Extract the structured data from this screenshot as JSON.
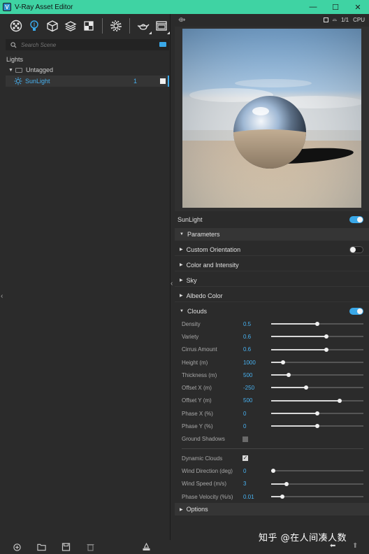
{
  "window": {
    "title": "V-Ray Asset Editor",
    "minimize": "—",
    "maximize": "☐",
    "close": "✕"
  },
  "toolbar": {
    "icons": [
      "materials-icon",
      "lights-icon",
      "geometry-icon",
      "render-elements-icon",
      "textures-icon",
      "settings-icon",
      "teapot-icon",
      "render-window-icon"
    ]
  },
  "search": {
    "placeholder": "Search Scene"
  },
  "tree": {
    "title": "Lights",
    "group": "Untagged",
    "item": {
      "name": "SunLight",
      "count": "1"
    }
  },
  "render_bar": {
    "mode": "CPU",
    "ratio": "1/1"
  },
  "props": {
    "object_name": "SunLight",
    "object_enabled": true,
    "section_parameters": "Parameters",
    "subsections": [
      {
        "label": "Custom Orientation",
        "toggle": "off"
      },
      {
        "label": "Color and Intensity"
      },
      {
        "label": "Sky"
      },
      {
        "label": "Albedo Color"
      }
    ],
    "clouds": {
      "label": "Clouds",
      "enabled": true,
      "params": [
        {
          "label": "Density",
          "value": "0.5",
          "pos": 0.5
        },
        {
          "label": "Variety",
          "value": "0.6",
          "pos": 0.6
        },
        {
          "label": "Cirrus Amount",
          "value": "0.6",
          "pos": 0.6
        },
        {
          "label": "Height (m)",
          "value": "1000",
          "pos": 0.13
        },
        {
          "label": "Thickness (m)",
          "value": "500",
          "pos": 0.19
        },
        {
          "label": "Offset X (m)",
          "value": "-250",
          "pos": 0.38
        },
        {
          "label": "Offset Y (m)",
          "value": "500",
          "pos": 0.74
        },
        {
          "label": "Phase X (%)",
          "value": "0",
          "pos": 0.5
        },
        {
          "label": "Phase Y (%)",
          "value": "0",
          "pos": 0.5
        }
      ],
      "ground_shadows": {
        "label": "Ground Shadows",
        "checked": false
      },
      "dynamic_clouds": {
        "label": "Dynamic Clouds",
        "checked": true
      },
      "dynamic_params": [
        {
          "label": "Wind Direction (deg)",
          "value": "0",
          "pos": 0.02
        },
        {
          "label": "Wind Speed (m/s)",
          "value": "3",
          "pos": 0.17
        },
        {
          "label": "Phase Velocity (%/s)",
          "value": "0.01",
          "pos": 0.12
        }
      ]
    },
    "section_options": "Options"
  },
  "watermark": "知乎 @在人间凑人数",
  "colors": {
    "titlebar": "#3fd3a3",
    "accent": "#3aa8e8",
    "value_text": "#48b1f0"
  }
}
